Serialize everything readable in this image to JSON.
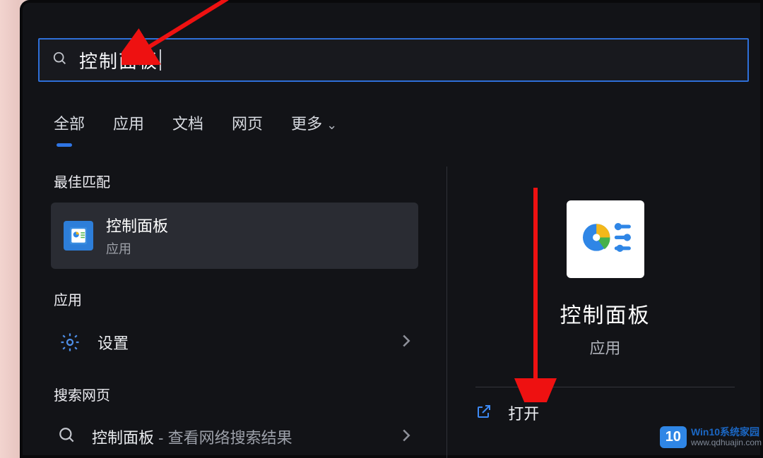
{
  "search": {
    "query": "控制面板"
  },
  "tabs": {
    "all": "全部",
    "apps": "应用",
    "docs": "文档",
    "web": "网页",
    "more": "更多"
  },
  "sections": {
    "best": "最佳匹配",
    "apps": "应用",
    "web": "搜索网页"
  },
  "bestMatch": {
    "title": "控制面板",
    "sub": "应用"
  },
  "rows": {
    "settings": "设置",
    "webResultPrefix": "控制面板",
    "webResultSuffix": " - 查看网络搜索结果"
  },
  "detail": {
    "title": "控制面板",
    "sub": "应用",
    "open": "打开"
  },
  "watermark": {
    "badge": "10",
    "line1": "Win10系统家园",
    "line2": "www.qdhuajin.com"
  }
}
